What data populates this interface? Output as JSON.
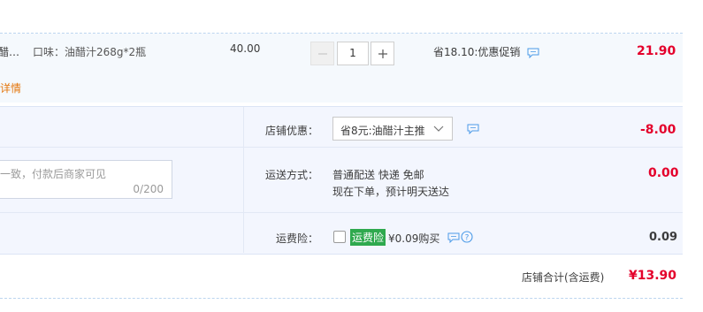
{
  "item": {
    "name_fragment": "醋…",
    "flavor": "口味：油醋汁268g*2瓶",
    "unit_price": "40.00",
    "quantity": "1",
    "promo": "省18.10:优惠促销",
    "subtotal": "21.90",
    "detail_link": "详情"
  },
  "shop_discount": {
    "label": "店铺优惠：",
    "selected": "省8元:油醋汁主推",
    "amount": "-8.00"
  },
  "shipping": {
    "label": "运送方式：",
    "method": "普通配送 快递 免邮",
    "eta": "现在下单，预计明天送达",
    "amount": "0.00"
  },
  "message": {
    "placeholder": "一致，付款后商家可见",
    "counter": "0/200"
  },
  "insurance": {
    "label": "运费险：",
    "badge": "运费险",
    "price_text": "¥0.09购买",
    "amount": "0.09"
  },
  "total": {
    "label": "店铺合计(含运费)",
    "amount": "¥13.90"
  },
  "colors": {
    "accent_red": "#e4002b",
    "link_orange": "#e4770e",
    "panel_bg": "#f3f6fe",
    "badge_green": "#2fa94e"
  },
  "icons": [
    "chat-icon",
    "chevron-down-icon",
    "minus-icon",
    "plus-icon",
    "help-icon",
    "checkbox"
  ]
}
